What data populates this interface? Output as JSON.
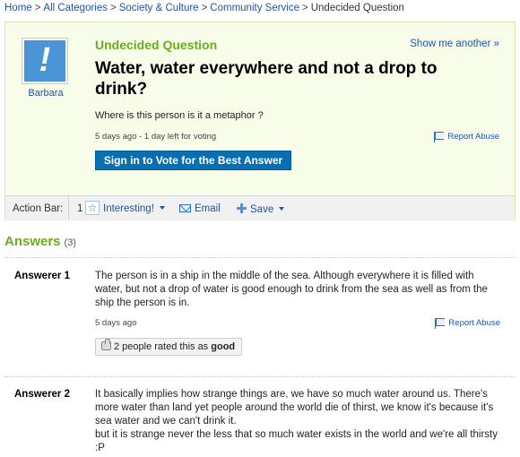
{
  "breadcrumb": {
    "items": [
      "Home",
      "All Categories",
      "Society & Culture",
      "Community Service"
    ],
    "current": "Undecided Question",
    "separator": ">"
  },
  "question": {
    "asker": "Barbara",
    "avatar_icon": "question-exclamation-avatar-icon",
    "status": "Undecided Question",
    "show_another": "Show me another »",
    "title": "Water, water everywhere and not a drop to drink?",
    "body": "Where is this person is it a metaphor ?",
    "meta": "5 days ago - 1 day left for voting",
    "report_abuse": "Report Abuse",
    "vote_button": "Sign in to Vote for the Best Answer"
  },
  "action_bar": {
    "label": "Action Bar:",
    "interesting_count": "1",
    "interesting_label": "Interesting!",
    "email_label": "Email",
    "save_label": "Save"
  },
  "answers": {
    "title": "Answers",
    "count": "(3)",
    "items": [
      {
        "answerer": "Answerer 1",
        "text": "The person is in a ship in the middle of the sea. Although everywhere it is filled with water, but not a drop of water is good enough to drink from the sea as well as from the ship the person is in.",
        "meta": "5 days ago",
        "report_abuse": "Report Abuse",
        "rating_prefix": "2 people rated this as",
        "rating_word": "good"
      },
      {
        "answerer": "Answerer 2",
        "text_lines": [
          "It basically implies how strange things are, we have so much water around us. There's more water than land yet people around the world die of thirst, we know it's because it's sea water and we can't drink it.",
          "but it is strange never the less that so much water exists in the world and we're all thirsty :P"
        ]
      }
    ]
  },
  "colors": {
    "link": "#1b56a5",
    "accent_green": "#6aac1e",
    "vote_button": "#0a6fb1",
    "question_bg": "#f7fde9",
    "avatar_blue": "#4a95d8"
  }
}
